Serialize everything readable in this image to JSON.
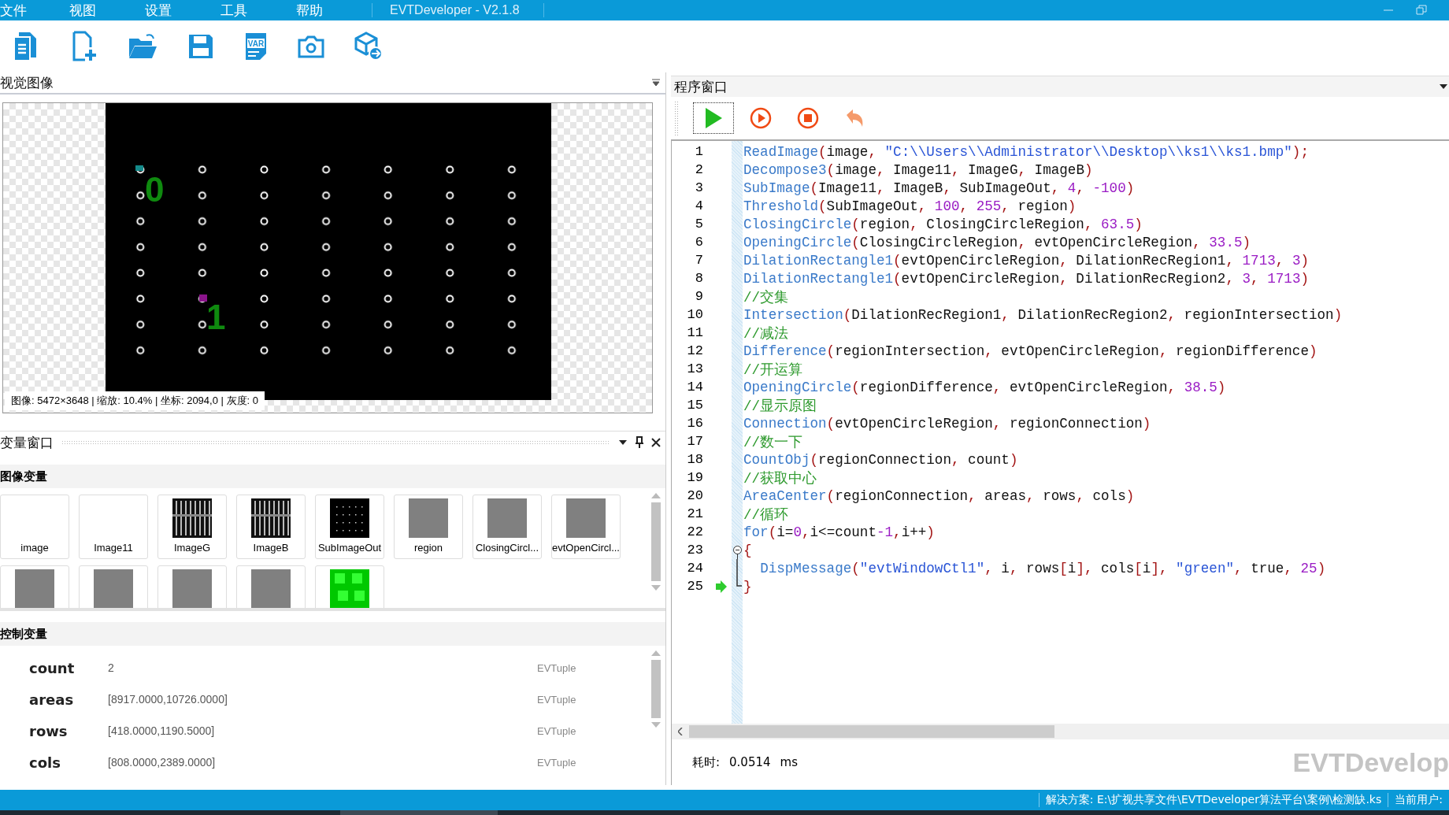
{
  "menu": [
    "文件",
    "视图",
    "设置",
    "工具",
    "帮助"
  ],
  "window": {
    "title": "EVTDeveloper - V2.1.8"
  },
  "toolbar": [
    {
      "kind": "documents"
    },
    {
      "kind": "new-file"
    },
    {
      "kind": "open-folder"
    },
    {
      "kind": "save"
    },
    {
      "kind": "var-file",
      "text": "VAR"
    },
    {
      "kind": "camera"
    },
    {
      "kind": "box-export"
    }
  ],
  "image_panel": {
    "title": "视觉图像",
    "overlays": [
      "0",
      "1"
    ],
    "info": "图像: 5472×3648 | 缩放: 10.4% | 坐标: 2094,0 | 灰度: 0"
  },
  "variable_panel": {
    "title": "变量窗口",
    "image_section": "图像变量",
    "images": [
      {
        "label": "image",
        "kind": "blank"
      },
      {
        "label": "Image11",
        "kind": "blank"
      },
      {
        "label": "ImageG",
        "kind": "stripes"
      },
      {
        "label": "ImageB",
        "kind": "stripes"
      },
      {
        "label": "SubImageOut",
        "kind": "dots"
      },
      {
        "label": "region",
        "kind": "gray"
      },
      {
        "label": "ClosingCircl...",
        "kind": "gray"
      },
      {
        "label": "evtOpenCircl...",
        "kind": "gray"
      },
      {
        "kind": "gray"
      },
      {
        "kind": "gray"
      },
      {
        "kind": "gray"
      },
      {
        "kind": "gray"
      },
      {
        "kind": "green"
      }
    ],
    "control_section": "控制变量",
    "controls": [
      {
        "name": "count",
        "value": "2",
        "type": "EVTuple"
      },
      {
        "name": "areas",
        "value": "[8917.0000,10726.0000]",
        "type": "EVTuple"
      },
      {
        "name": "rows",
        "value": "[418.0000,1190.5000]",
        "type": "EVTuple"
      },
      {
        "name": "cols",
        "value": "[808.0000,2389.0000]",
        "type": "EVTuple"
      }
    ]
  },
  "program_panel": {
    "title": "程序窗口",
    "toolbar": [
      {
        "kind": "run",
        "focused": true
      },
      {
        "kind": "step",
        "focused": false
      },
      {
        "kind": "stop",
        "focused": false
      },
      {
        "kind": "undo",
        "focused": false
      }
    ],
    "lines": [
      {
        "n": "1",
        "code": "ReadImage(image, \"C:\\\\Users\\\\Administrator\\\\Desktop\\\\ks1\\\\ks1.bmp\");",
        "current": false
      },
      {
        "n": "2",
        "code": "Decompose3(image, Image11, ImageG, ImageB)",
        "current": false
      },
      {
        "n": "3",
        "code": "SubImage(Image11, ImageB, SubImageOut, 4, -100)",
        "current": false
      },
      {
        "n": "4",
        "code": "Threshold(SubImageOut, 100, 255, region)",
        "current": false
      },
      {
        "n": "5",
        "code": "ClosingCircle(region, ClosingCircleRegion, 63.5)",
        "current": false
      },
      {
        "n": "6",
        "code": "OpeningCircle(ClosingCircleRegion, evtOpenCircleRegion, 33.5)",
        "current": false
      },
      {
        "n": "7",
        "code": "DilationRectangle1(evtOpenCircleRegion, DilationRecRegion1, 1713, 3)",
        "current": false
      },
      {
        "n": "8",
        "code": "DilationRectangle1(evtOpenCircleRegion, DilationRecRegion2, 3, 1713)",
        "current": false
      },
      {
        "n": "9",
        "code": "//交集",
        "current": false
      },
      {
        "n": "10",
        "code": "Intersection(DilationRecRegion1, DilationRecRegion2, regionIntersection)",
        "current": false
      },
      {
        "n": "11",
        "code": "//减法",
        "current": false
      },
      {
        "n": "12",
        "code": "Difference(regionIntersection, evtOpenCircleRegion, regionDifference)",
        "current": false
      },
      {
        "n": "13",
        "code": "//开运算",
        "current": false
      },
      {
        "n": "14",
        "code": "OpeningCircle(regionDifference, evtOpenCircleRegion, 38.5)",
        "current": false
      },
      {
        "n": "15",
        "code": "//显示原图",
        "current": false
      },
      {
        "n": "16",
        "code": "Connection(evtOpenCircleRegion, regionConnection)",
        "current": false
      },
      {
        "n": "17",
        "code": "//数一下",
        "current": false
      },
      {
        "n": "18",
        "code": "CountObj(regionConnection, count)",
        "current": false
      },
      {
        "n": "19",
        "code": "//获取中心",
        "current": false
      },
      {
        "n": "20",
        "code": "AreaCenter(regionConnection, areas, rows, cols)",
        "current": false
      },
      {
        "n": "21",
        "code": "//循环",
        "current": false
      },
      {
        "n": "22",
        "code": "for(i=0,i<=count-1,i++)",
        "current": false
      },
      {
        "n": "23",
        "code": "{",
        "current": false,
        "kind": "fold-start"
      },
      {
        "n": "24",
        "code": "  DispMessage(\"evtWindowCtl1\", i, rows[i], cols[i], \"green\", true, 25)",
        "current": false,
        "kind": "fold-body"
      },
      {
        "n": "25",
        "code": "}",
        "current": true,
        "kind": "fold-end"
      }
    ],
    "timing": {
      "label": "耗时:",
      "value": "0.0514",
      "unit": "ms"
    },
    "watermark": "EVTDevelop"
  },
  "status_bar": [
    "解决方案: E:\\扩视共享文件\\EVTDeveloper算法平台\\案例\\检测缺.ks",
    "当前用户:"
  ]
}
